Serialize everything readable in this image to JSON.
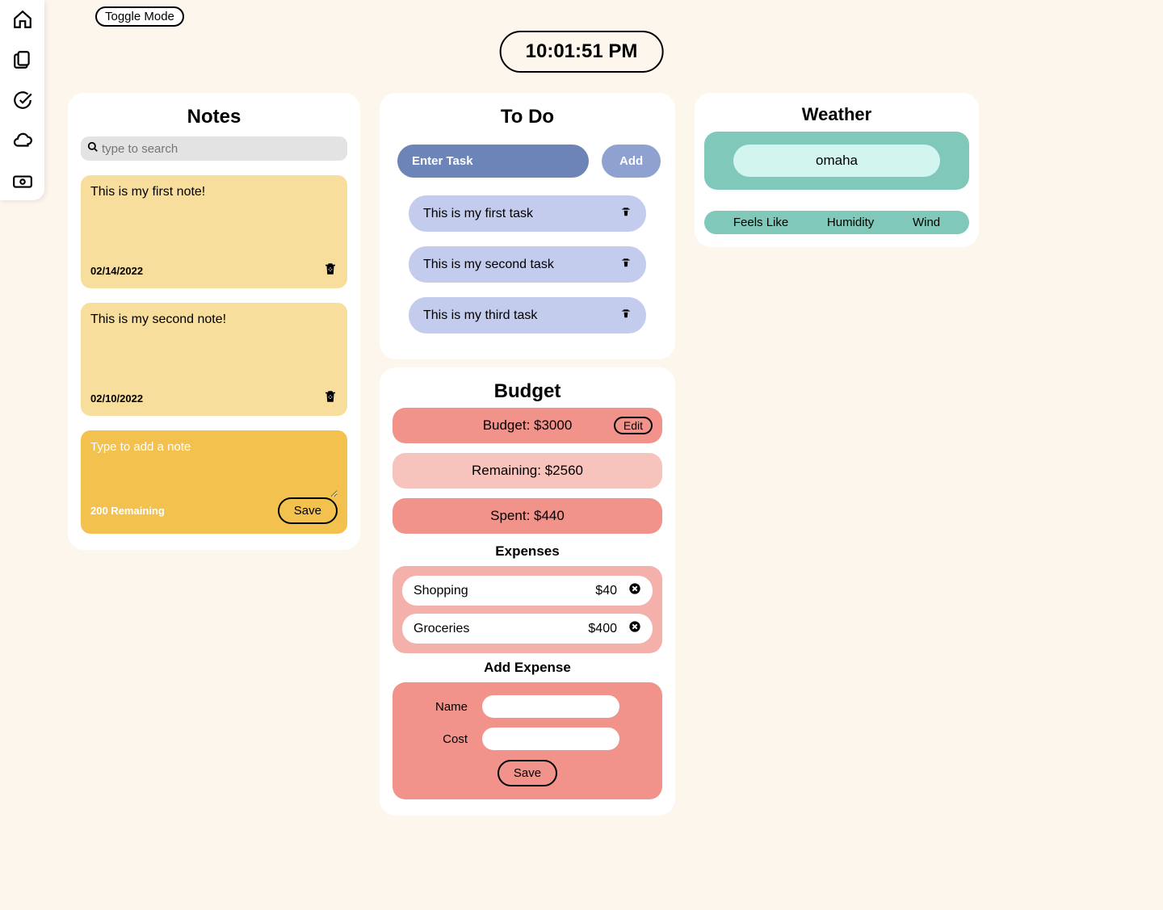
{
  "toggle_label": "Toggle Mode",
  "clock": "10:01:51 PM",
  "sidebar": {
    "items": [
      "home",
      "copy",
      "check",
      "cloud",
      "money"
    ]
  },
  "notes": {
    "title": "Notes",
    "search_placeholder": "type to search",
    "items": [
      {
        "text": "This is my first note!",
        "date": "02/14/2022"
      },
      {
        "text": "This is my second note!",
        "date": "02/10/2022"
      }
    ],
    "new_placeholder": "Type to add a note",
    "remaining": "200 Remaining",
    "save_label": "Save"
  },
  "todo": {
    "title": "To Do",
    "input_placeholder": "Enter Task",
    "add_label": "Add",
    "tasks": [
      "This is my first task",
      "This is my second task",
      "This is my third task"
    ]
  },
  "budget": {
    "title": "Budget",
    "budget_line": "Budget: $3000",
    "edit_label": "Edit",
    "remaining_line": "Remaining: $2560",
    "spent_line": "Spent: $440",
    "expenses_title": "Expenses",
    "expenses": [
      {
        "name": "Shopping",
        "amount": "$40"
      },
      {
        "name": "Groceries",
        "amount": "$400"
      }
    ],
    "add_expense_title": "Add Expense",
    "name_label": "Name",
    "cost_label": "Cost",
    "save_label": "Save"
  },
  "weather": {
    "title": "Weather",
    "city": "omaha",
    "stats": {
      "feels": "Feels Like",
      "humidity": "Humidity",
      "wind": "Wind"
    }
  }
}
